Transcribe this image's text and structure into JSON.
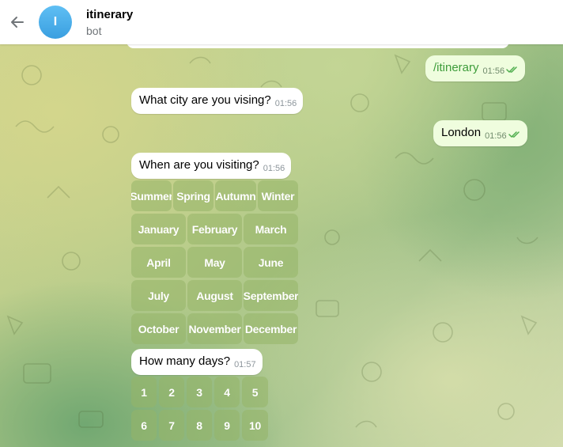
{
  "header": {
    "back_icon": "arrow-left-icon",
    "avatar_letter": "I",
    "title": "itinerary",
    "subtitle": "bot"
  },
  "messages": {
    "cmd": {
      "text": "/itinerary",
      "time": "01:56",
      "status": "read"
    },
    "q_city": {
      "text": "What city are you vising?",
      "time": "01:56"
    },
    "a_city": {
      "text": "London",
      "time": "01:56",
      "status": "read"
    },
    "q_when": {
      "text": "When are you visiting?",
      "time": "01:56"
    },
    "q_days": {
      "text": "How many days?",
      "time": "01:57"
    }
  },
  "keyboard_when": {
    "seasons": [
      "Summer",
      "Spring",
      "Autumn",
      "Winter"
    ],
    "months": [
      [
        "January",
        "February",
        "March"
      ],
      [
        "April",
        "May",
        "June"
      ],
      [
        "July",
        "August",
        "September"
      ],
      [
        "October",
        "November",
        "December"
      ]
    ]
  },
  "keyboard_days": {
    "rows": [
      [
        "1",
        "2",
        "3",
        "4",
        "5"
      ],
      [
        "6",
        "7",
        "8",
        "9",
        "10"
      ]
    ]
  },
  "colors": {
    "accent": "#3a9fe0",
    "outgoing_bubble": "#effdde",
    "incoming_bubble": "#ffffff",
    "read_check": "#4fae4e"
  }
}
